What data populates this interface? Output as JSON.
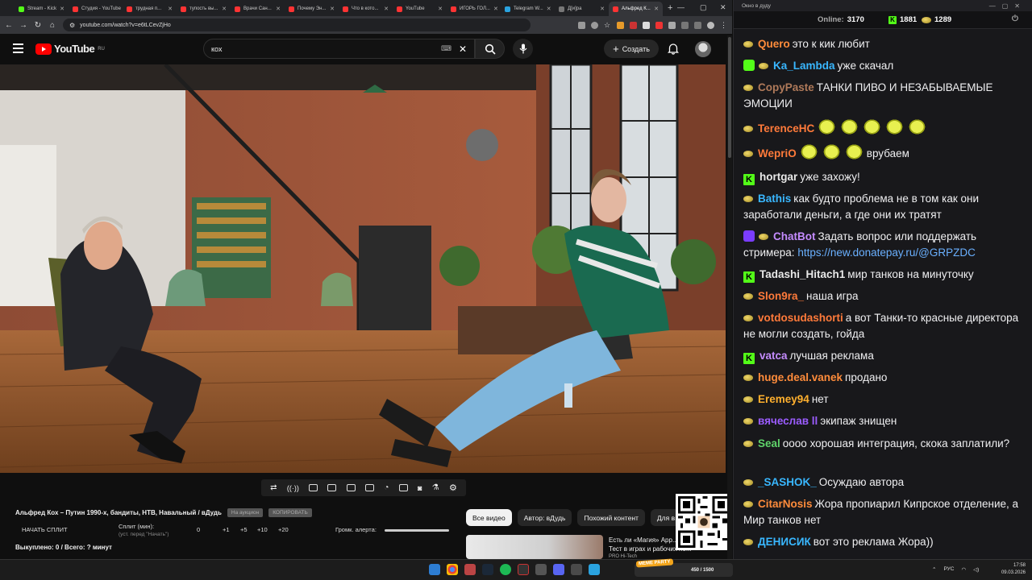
{
  "browser": {
    "tabs": [
      {
        "label": "Stream - Kick",
        "color": "#53fc18",
        "active": false
      },
      {
        "label": "Студия - YouTube",
        "color": "#ff3333",
        "active": false
      },
      {
        "label": "трудная п...",
        "color": "#ff3333",
        "active": false
      },
      {
        "label": "тупость вы...",
        "color": "#ff3333",
        "active": false
      },
      {
        "label": "Врачи Сан...",
        "color": "#ff3333",
        "active": false
      },
      {
        "label": "Почему Эн...",
        "color": "#ff3333",
        "active": false
      },
      {
        "label": "Что в кото...",
        "color": "#ff3333",
        "active": false
      },
      {
        "label": "YouTube",
        "color": "#ff3333",
        "active": false
      },
      {
        "label": "ИГОРЬ ГОЛ...",
        "color": "#ff3333",
        "active": false
      },
      {
        "label": "Telegram W...",
        "color": "#2aa3e0",
        "active": false
      },
      {
        "label": "Д[и]ра",
        "color": "#777777",
        "active": false
      },
      {
        "label": "Альфред К...",
        "color": "#ff3333",
        "active": true
      }
    ],
    "new_tab": "+",
    "url": "youtube.com/watch?v=e6tLCevZjHo"
  },
  "youtube": {
    "logo_text": "YouTube",
    "region": "RU",
    "search_value": "кох",
    "create_label": "Создать",
    "video_title": "Альфред Кох – Путин 1990-х, бандиты, НТВ, Навальный / вДудь",
    "pill_auction": "На аукцион",
    "pill_copy": "КОПИРОВАТЬ",
    "split_start": "НАЧАТЬ СПЛИТ",
    "split_label": "Сплит (мин):",
    "split_hint": "(уст. перед \"Начать\")",
    "split_zero": "0",
    "split_buttons": [
      "+1",
      "+5",
      "+10",
      "+20"
    ],
    "alert_volume_label": "Громк. алерта:",
    "bought_text": "Выкуплено: 0 / Всего: ? минут",
    "chips": [
      "Все видео",
      "Автор: вДудь",
      "Похожий контент",
      "Для в..."
    ],
    "rec_title_1": "Есть ли «Магия» App...",
    "rec_title_2": "Тест в играх и рабочих по...",
    "rec_channel": "PRO Hi-Tech"
  },
  "chat": {
    "window_title": "Окно в дуду",
    "online_label": "Online:",
    "online_count": "3170",
    "kick_count": "1881",
    "coin_count": "1289",
    "messages": [
      {
        "nick": "Quero",
        "color": "#ff8c3b",
        "badges": [
          "coin"
        ],
        "text": "это к кик любит"
      },
      {
        "nick": "Ka_Lambda",
        "color": "#39b7ff",
        "badges": [
          "shield",
          "coin"
        ],
        "text": "уже скачал"
      },
      {
        "nick": "CopyPaste",
        "color": "#b07a5a",
        "badges": [
          "coin"
        ],
        "text": "ТАНКИ ПИВО И НЕЗАБЫВАЕМЫЕ ЭМОЦИИ"
      },
      {
        "nick": "TerenceHC",
        "color": "#ff7a3a",
        "badges": [
          "coin"
        ],
        "emotes": 5,
        "text": ""
      },
      {
        "nick": "WepriO",
        "color": "#ff7a3a",
        "badges": [
          "coin"
        ],
        "emotes": 3,
        "text": "врубаем"
      },
      {
        "nick": "hortgar",
        "color": "#e8e8e8",
        "badges": [
          "kick"
        ],
        "text": "уже захожу!"
      },
      {
        "nick": "Bathis",
        "color": "#39b7ff",
        "badges": [
          "coin"
        ],
        "text": "как будто проблема не в том как они заработали деньги, а где они их тратят"
      },
      {
        "nick": "ChatBot",
        "color": "#c58cff",
        "badges": [
          "bot",
          "coin"
        ],
        "text": "Задать вопрос или поддержать стримера:",
        "link": "https://new.donatepay.ru/@GRPZDC"
      },
      {
        "nick": "Tadashi_Hitach1",
        "color": "#e8e8e8",
        "badges": [
          "kick"
        ],
        "text": "мир танков на минуточку"
      },
      {
        "nick": "Slon9ra_",
        "color": "#ff7a3a",
        "badges": [
          "coin"
        ],
        "text": "наша игра"
      },
      {
        "nick": "votdosudashorti",
        "color": "#ff7a3a",
        "badges": [
          "coin"
        ],
        "text": "а вот Танки-то красные директора не могли создать, гойда"
      },
      {
        "nick": "vatca",
        "color": "#c58cff",
        "badges": [
          "kick"
        ],
        "text": "лучшая реклама"
      },
      {
        "nick": "huge.deal.vanek",
        "color": "#ff8c3b",
        "badges": [
          "coin"
        ],
        "text": "продано"
      },
      {
        "nick": "Eremey94",
        "color": "#ffb02e",
        "badges": [
          "coin"
        ],
        "text": "нет"
      },
      {
        "nick": "вячеслав ll",
        "color": "#9b5cff",
        "badges": [
          "coin"
        ],
        "text": "экипаж знищен"
      },
      {
        "nick": "Seal",
        "color": "#5fd36a",
        "badges": [
          "coin"
        ],
        "text": "оооо хорошая интеграция, скока заплатили?"
      },
      {
        "nick": "_SASHOK_",
        "color": "#39b7ff",
        "badges": [
          "coin"
        ],
        "text": "Осуждаю автора"
      },
      {
        "nick": "CitarNosis",
        "color": "#ff8c3b",
        "badges": [
          "coin"
        ],
        "text": "Жора пропиарил Кипрское отделение, а Мир танков нет"
      },
      {
        "nick": "ДЕНИСИК",
        "color": "#39b7ff",
        "badges": [
          "coin"
        ],
        "text": "вот это реклама Жора))"
      }
    ]
  },
  "taskbar": {
    "meme_label": "MEME PARTY",
    "meme_progress": "450 / 1500",
    "lang": "РУС",
    "time": "17:58",
    "date": "09.03.2026"
  }
}
